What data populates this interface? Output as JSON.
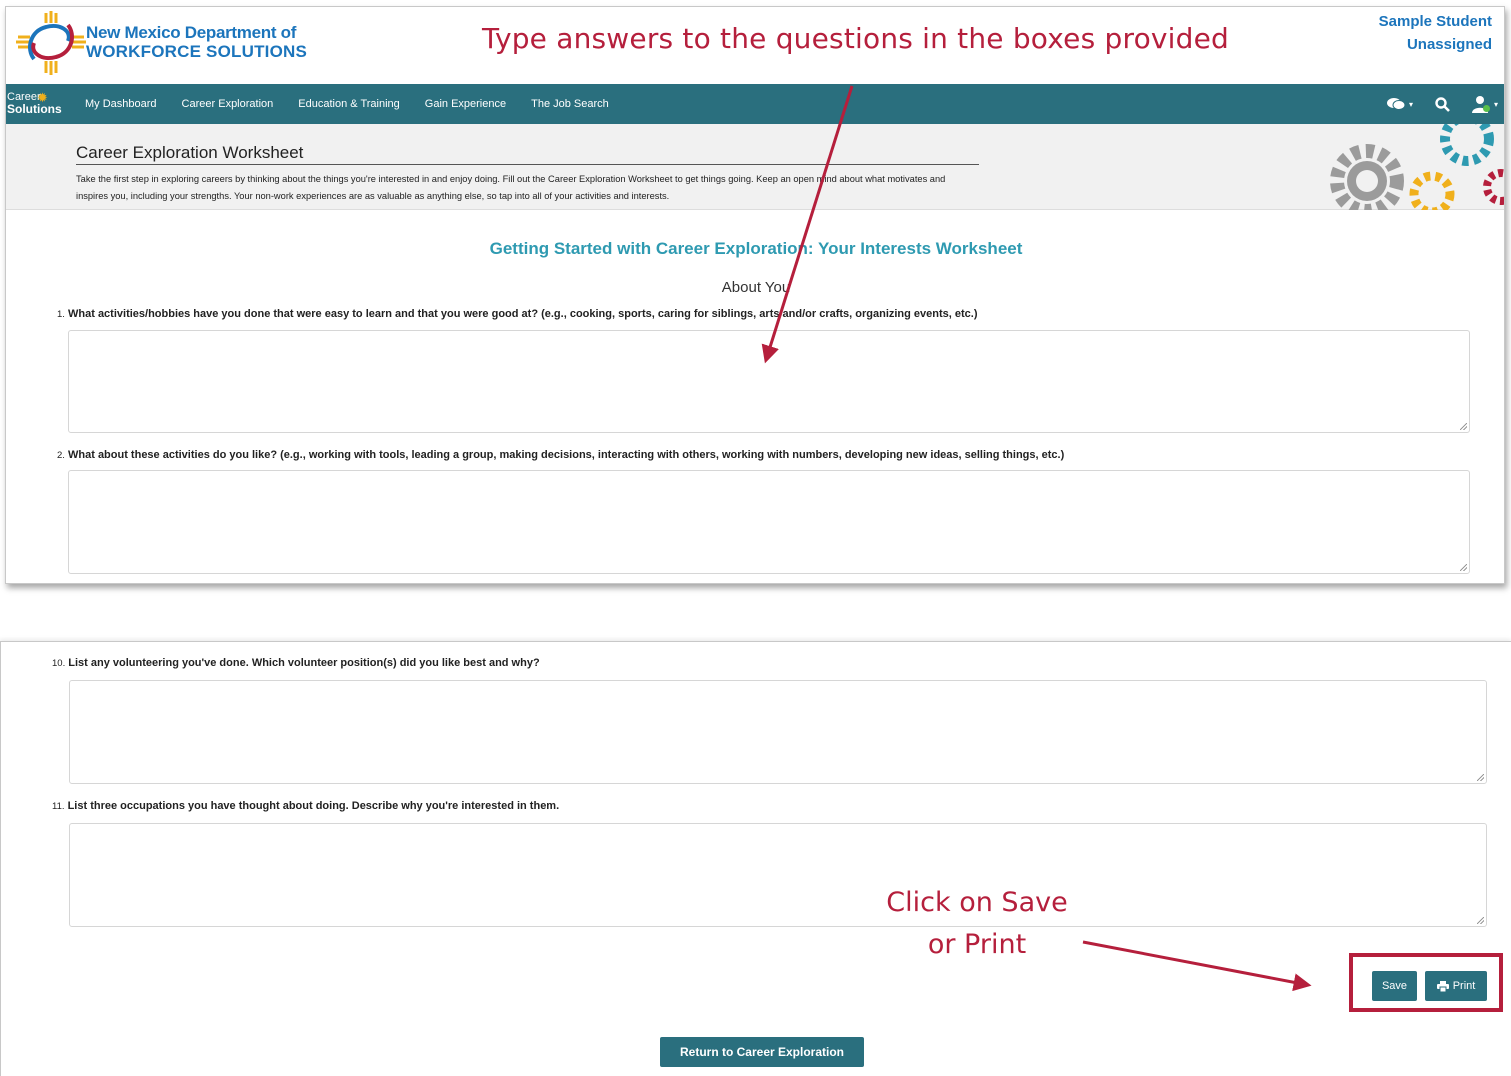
{
  "annotations": {
    "top_callout": "Type answers to the questions in the boxes provided",
    "bottom_callout_line1": "Click on Save",
    "bottom_callout_line2": "or Print",
    "accent_color": "#b51f3c"
  },
  "brand": {
    "line1": "New Mexico Department of",
    "line2": "WORKFORCE SOLUTIONS",
    "color": "#1c75bc"
  },
  "user": {
    "name": "Sample Student",
    "status": "Unassigned"
  },
  "navbar": {
    "logo_line1": "Career",
    "logo_line2": "Solutions",
    "color": "#2a6f7e",
    "items": [
      {
        "label": "My Dashboard"
      },
      {
        "label": "Career Exploration"
      },
      {
        "label": "Education & Training"
      },
      {
        "label": "Gain Experience"
      },
      {
        "label": "The Job Search"
      }
    ],
    "icons": [
      "chat-icon",
      "search-icon",
      "user-icon"
    ]
  },
  "page_header": {
    "title": "Career Exploration Worksheet",
    "description": "Take the first step in exploring careers by thinking about the things you're interested in and enjoy doing. Fill out the Career Exploration Worksheet to get things going. Keep an open mind about what motivates and inspires you, including your strengths. Your non-work experiences are as valuable as anything else, so tap into all of your activities and interests."
  },
  "worksheet": {
    "title": "Getting Started with Career Exploration: Your Interests Worksheet",
    "section": "About You",
    "questions": [
      {
        "number": "1.",
        "text": "What activities/hobbies have you done that were easy to learn and that you were good at? (e.g., cooking, sports, caring for siblings, arts and/or crafts, organizing events, etc.)",
        "value": ""
      },
      {
        "number": "2.",
        "text": "What about these activities do you like? (e.g., working with tools, leading a group, making decisions, interacting with others, working with numbers, developing new ideas, selling things, etc.)",
        "value": ""
      },
      {
        "number": "10.",
        "text": "List any volunteering you've done. Which volunteer position(s) did you like best and why?",
        "value": ""
      },
      {
        "number": "11.",
        "text": "List three occupations you have thought about doing. Describe why you're interested in them.",
        "value": ""
      }
    ]
  },
  "actions": {
    "save_label": "Save",
    "print_label": "Print",
    "return_label": "Return to Career Exploration"
  }
}
